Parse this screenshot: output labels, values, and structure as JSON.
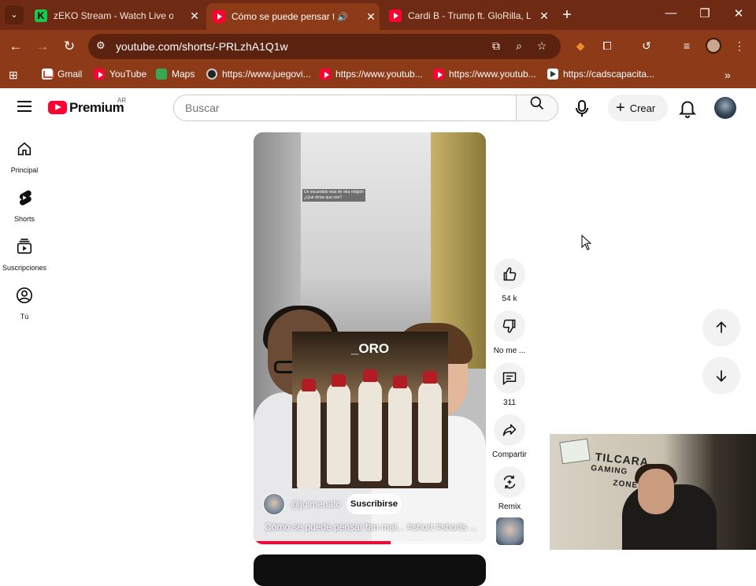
{
  "browser": {
    "tabs": [
      {
        "title": "zEKO Stream - Watch Live on Ki",
        "active": false
      },
      {
        "title": "Cómo se puede pensar tan",
        "active": true
      },
      {
        "title": "Cardi B - Trump ft. GloRilla, Latt",
        "active": false
      }
    ],
    "url": "youtube.com/shorts/-PRLzhA1Q1w",
    "bookmarks": [
      "Gmail",
      "YouTube",
      "Maps",
      "https://www.juegovi...",
      "https://www.youtub...",
      "https://www.youtub...",
      "https://cadscapacita..."
    ],
    "colors": {
      "frame": "#8c3a18",
      "tabstrip": "#6e2a12",
      "omnibox": "#5c2210"
    }
  },
  "youtube": {
    "brand": "Premium",
    "region": "AR",
    "search": {
      "placeholder": "Buscar",
      "value": ""
    },
    "create_label": "Crear",
    "sidebar": [
      {
        "label": "Principal",
        "icon": "home-icon"
      },
      {
        "label": "Shorts",
        "icon": "shorts-icon"
      },
      {
        "label": "Suscripciones",
        "icon": "subscriptions-icon"
      },
      {
        "label": "Tú",
        "icon": "you-icon"
      }
    ],
    "short": {
      "caption_line1": "Un escandalo mas de otra religión",
      "caption_line2": "¿Qué dirías que son?",
      "overlay_title": "_ORO",
      "channel": "@julmenato",
      "subscribe_label": "Suscribirse",
      "title": "Cómo se puede pensar tan mal... #short #shorts ...",
      "progress": 0.59
    },
    "actions": [
      {
        "label": "54 k",
        "icon": "like-icon"
      },
      {
        "label": "No me ...",
        "icon": "dislike-icon"
      },
      {
        "label": "311",
        "icon": "comments-icon"
      },
      {
        "label": "Compartir",
        "icon": "share-icon"
      },
      {
        "label": "Remix",
        "icon": "remix-icon"
      }
    ],
    "accent": "#ff0033"
  },
  "webcam": {
    "sign_line1": "TILCARA",
    "sign_line2": "GAMING",
    "sign_line3": "ZONE"
  }
}
